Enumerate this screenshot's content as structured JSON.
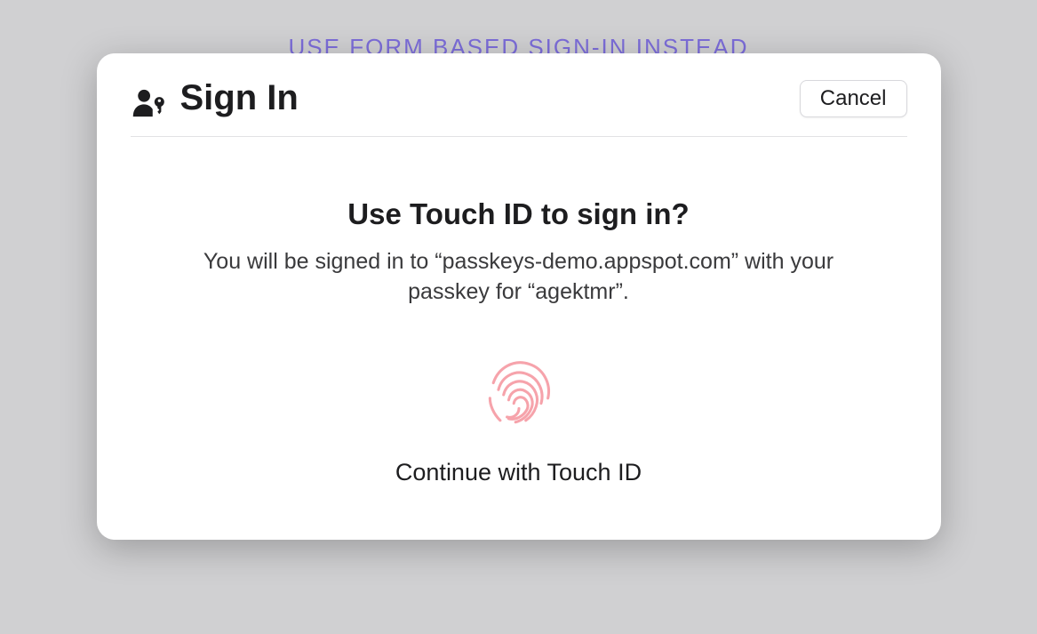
{
  "background": {
    "alt_signin_link": "USE FORM BASED SIGN-IN INSTEAD"
  },
  "dialog": {
    "title": "Sign In",
    "cancel_label": "Cancel",
    "prompt_heading": "Use Touch ID to sign in?",
    "prompt_subtext": "You will be signed in to “passkeys-demo.appspot.com” with your passkey for “agektmr”.",
    "continue_label": "Continue with Touch ID"
  },
  "icons": {
    "title_icon": "passkey-icon",
    "fingerprint": "fingerprint-icon"
  },
  "colors": {
    "link": "#7c6dd9",
    "fingerprint": "#f6a3ab",
    "dialog_bg": "#ffffff",
    "page_bg": "#d0d0d2"
  }
}
